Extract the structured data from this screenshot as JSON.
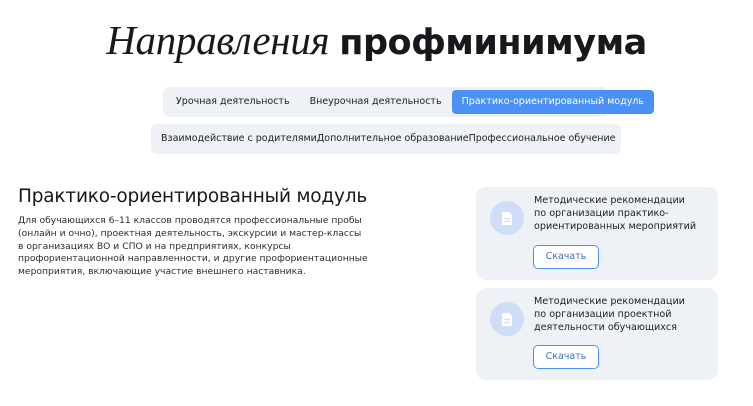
{
  "header": {
    "title_light": "Направления",
    "title_bold": "профминимума"
  },
  "tabs_row1": [
    {
      "label": "Урочная деятельность",
      "active": false
    },
    {
      "label": "Внеурочная деятельность",
      "active": false
    },
    {
      "label": "Практико-ориентированный модуль",
      "active": true
    }
  ],
  "tabs_row2": [
    {
      "label": "Взаимодействие с родителями",
      "active": false
    },
    {
      "label": "Дополнительное образование",
      "active": false
    },
    {
      "label": "Профессиональное обучение",
      "active": false
    }
  ],
  "section": {
    "title": "Практико-ориентированный модуль",
    "lines": [
      "Для обучающихся 6–11 классов проводятся профессиональные пробы",
      "(онлайн и очно), проектная деятельность, экскурсии и мастер-классы",
      "в организациях ВО и СПО и на предприятиях, конкурсы",
      "профориентационной направленности, и другие профориентационные",
      "мероприятия, включающие участие внешнего наставника."
    ]
  },
  "cards": [
    {
      "icon": "document-icon",
      "lines": [
        "Методические рекомендации",
        "по организации практико-",
        "ориентированных мероприятий"
      ],
      "button_label": "Скачать"
    },
    {
      "icon": "document-icon",
      "lines": [
        "Методические рекомендации",
        "по организации проектной",
        "деятельности обучающихся"
      ],
      "button_label": "Скачать"
    }
  ],
  "colors": {
    "accent": "#4a90f5",
    "panel": "#eef1f6",
    "icon_circle": "#cfddf7"
  }
}
